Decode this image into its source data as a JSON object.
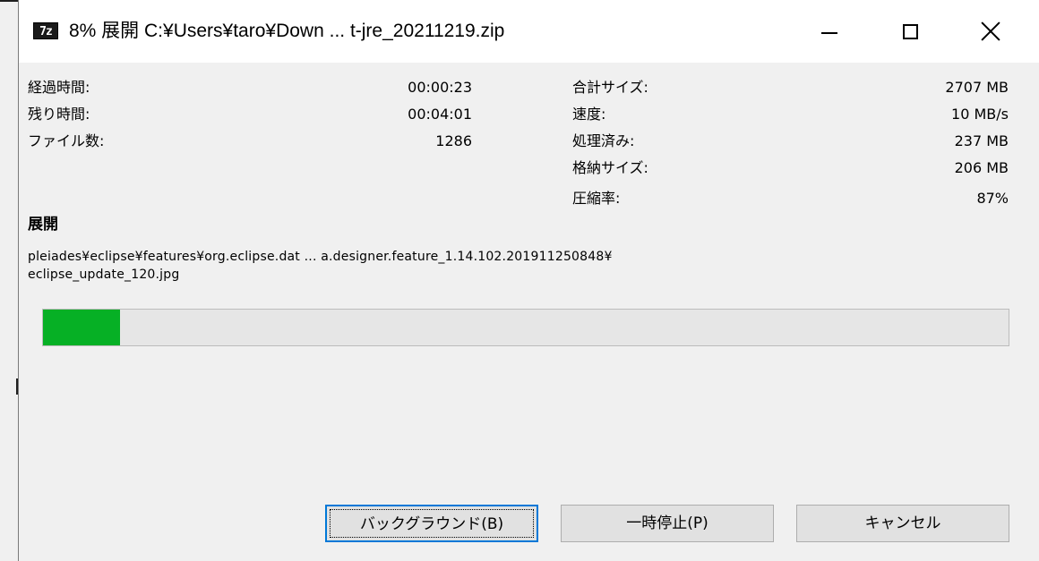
{
  "window": {
    "icon_text": "7z",
    "title": "8% 展開 C:¥Users¥taro¥Down ... t-jre_20211219.zip"
  },
  "stats_left": [
    {
      "label": "経過時間:",
      "value": "00:00:23"
    },
    {
      "label": "残り時間:",
      "value": "00:04:01"
    },
    {
      "label": "ファイル数:",
      "value": "1286"
    }
  ],
  "stats_right": [
    {
      "label": "合計サイズ:",
      "value": "2707 MB"
    },
    {
      "label": "速度:",
      "value": "10 MB/s"
    },
    {
      "label": "処理済み:",
      "value": "237 MB"
    },
    {
      "label": "格納サイズ:",
      "value": "206 MB"
    },
    {
      "label": "圧縮率:",
      "value": "87%"
    }
  ],
  "operation": {
    "heading": "展開",
    "path_line1": "pleiades¥eclipse¥features¥org.eclipse.dat ... a.designer.feature_1.14.102.201911250848¥",
    "path_line2": "eclipse_update_120.jpg"
  },
  "progress": {
    "percent": 8,
    "color": "#06b025"
  },
  "buttons": {
    "background": "バックグラウンド(B)",
    "pause": "一時停止(P)",
    "cancel": "キャンセル"
  }
}
